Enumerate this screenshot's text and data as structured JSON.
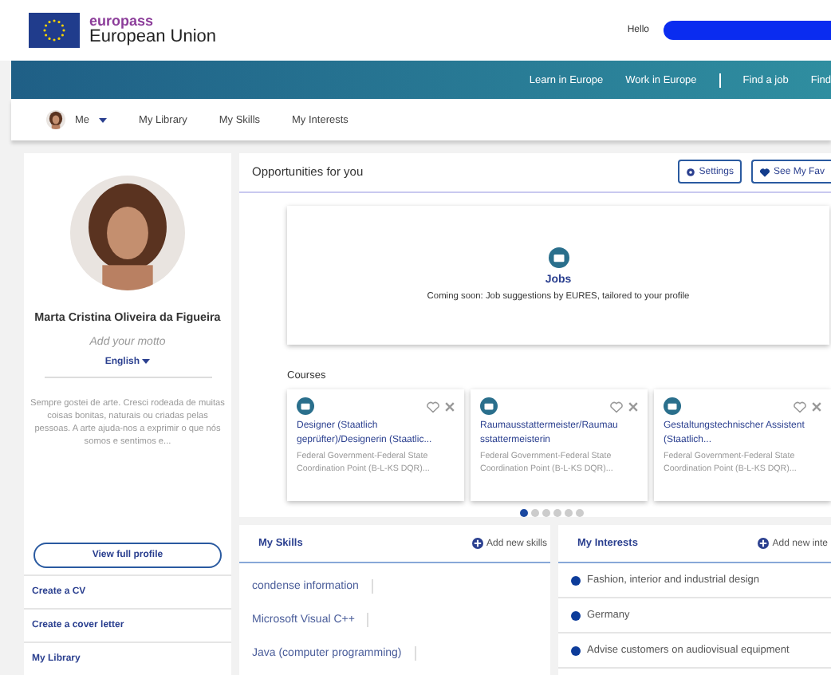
{
  "header": {
    "brand": "europass",
    "subtitle": "European Union",
    "greeting": "Hello"
  },
  "top_nav": [
    {
      "label": "Learn in Europe"
    },
    {
      "label": "Work in Europe"
    },
    {
      "label": "Find a job"
    },
    {
      "label": "Find"
    }
  ],
  "sub_nav": [
    {
      "label": "Me",
      "kind": "avatar"
    },
    {
      "label": "My Library",
      "kind": "link"
    },
    {
      "label": "My Skills",
      "kind": "link"
    },
    {
      "label": "My Interests",
      "kind": "link"
    }
  ],
  "profile": {
    "name": "Marta Cristina Oliveira da Figueira",
    "motto_placeholder": "Add your motto",
    "language": "English",
    "bio": "Sempre gostei de arte. Cresci rodeada de muitas coisas bonitas, naturais ou criadas pelas pessoas. A arte ajuda-nos a exprimir o que nós somos e sentimos e...",
    "button": "View full profile",
    "links": [
      "Create a CV",
      "Create a cover letter",
      "My Library"
    ]
  },
  "opportunities": {
    "title": "Opportunities for you",
    "buttons": [
      "Settings",
      "See My Fav"
    ],
    "jobs": {
      "title": "Jobs",
      "text": "Coming soon: Job suggestions by EURES, tailored to your profile"
    },
    "courses_title": "Courses",
    "courses": [
      {
        "title": "Designer (Staatlich geprüfter)/Designerin (Staatlic...",
        "provider": "Federal Government-Federal State Coordination Point (B-L-KS DQR)..."
      },
      {
        "title": "Raumausstattermeister/Raumau sstattermeisterin",
        "provider": "Federal Government-Federal State Coordination Point (B-L-KS DQR)..."
      },
      {
        "title": "Gestaltungstechnischer Assistent (Staatlich...",
        "provider": "Federal Government-Federal State Coordination Point (B-L-KS DQR)..."
      }
    ],
    "pages": [
      {
        "selected": true
      },
      {
        "selected": false
      },
      {
        "selected": false
      },
      {
        "selected": false
      },
      {
        "selected": false
      },
      {
        "selected": false
      }
    ]
  },
  "skills": {
    "title": "My Skills",
    "add": "Add new skills",
    "items": [
      "condense information",
      "Microsoft Visual C++",
      "Java (computer programming)"
    ]
  },
  "interests": {
    "title": "My Interests",
    "add": "Add new inte",
    "items": [
      "Fashion, interior and industrial design",
      "Germany",
      "Advise customers on audiovisual equipment"
    ]
  }
}
